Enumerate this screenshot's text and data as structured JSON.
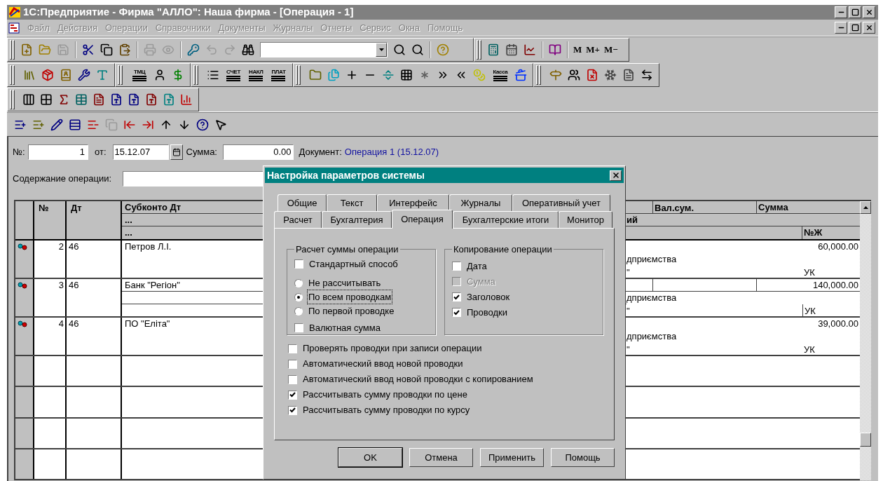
{
  "window": {
    "title": "1С:Предприятие - Фирма \"АЛЛО\": Наша фирма - [Операция - 1]"
  },
  "menu": [
    {
      "label": "Файл",
      "disabled": true
    },
    {
      "label": "Действия",
      "disabled": true
    },
    {
      "label": "Операции",
      "disabled": true
    },
    {
      "label": "Справочники",
      "disabled": true
    },
    {
      "label": "Документы",
      "disabled": true
    },
    {
      "label": "Журналы",
      "disabled": true
    },
    {
      "label": "Отчеты",
      "disabled": true
    },
    {
      "label": "Сервис",
      "disabled": true
    },
    {
      "label": "Окна",
      "disabled": true
    },
    {
      "label": "Помощь",
      "disabled": true
    }
  ],
  "toolbar_1": {
    "buttons": [
      {
        "disabled": false
      },
      {
        "disabled": false
      },
      {
        "disabled": true
      },
      {
        "disabled": false
      },
      {
        "disabled": false
      },
      {
        "disabled": false
      },
      {
        "disabled": true
      },
      {
        "disabled": true
      },
      {
        "disabled": false
      },
      {
        "disabled": true
      },
      {
        "disabled": true
      },
      {
        "disabled": false
      },
      {
        "disabled": false
      },
      {
        "disabled": false
      },
      {
        "disabled": false
      },
      {
        "disabled": false
      },
      {
        "disabled": false
      },
      {
        "disabled": false
      },
      {
        "disabled": false
      }
    ],
    "memory_buttons": [
      "M",
      "M+",
      "M−"
    ]
  },
  "toolbar_2": {
    "labels": [
      "ТМЦ",
      "СЧЕТ",
      "НАКЛ",
      "ПЛАТ",
      "Касса"
    ]
  },
  "toolbar_4": {
    "buttons": [
      {
        "disabled": false
      },
      {
        "disabled": false
      },
      {
        "disabled": false
      },
      {
        "disabled": false
      },
      {
        "disabled": false
      },
      {
        "disabled": true
      },
      {
        "disabled": false
      },
      {
        "disabled": false
      },
      {
        "disabled": false
      },
      {
        "disabled": false
      },
      {
        "disabled": false
      },
      {
        "disabled": false
      }
    ]
  },
  "form": {
    "number_label": "№:",
    "number": "1",
    "date_label": "от:",
    "date": "15.12.07",
    "sum_label": "Сумма:",
    "sum": "0.00",
    "document_label": "Документ:",
    "document_link": "Операция 1 (15.12.07)",
    "content_label": "Содержание операции:"
  },
  "table": {
    "header": {
      "number": "№",
      "debit": "Дт",
      "subkonto": [
        "Субконто Дт",
        "...",
        "..."
      ],
      "currency_sum": "Вал.сум.",
      "sum": "Сумма",
      "line_2": "ий",
      "journal": "№Ж"
    },
    "rows": [
      {
        "number": "2",
        "debit": "46",
        "subkonto": "Петров Л.І.",
        "amount": "60,000.00",
        "line_2": "дприємства",
        "line_3": "\"",
        "journal": "УК",
        "selected": false
      },
      {
        "number": "3",
        "debit": "46",
        "subkonto": "Банк \"Регіон\"",
        "amount": "140,000.00",
        "line_2": "дприємства",
        "line_3": "\"",
        "journal": "УК",
        "selected": true
      },
      {
        "number": "4",
        "debit": "46",
        "subkonto": "ПО \"Еліта\"",
        "amount": "39,000.00",
        "line_2": "дприємства",
        "line_3": "\"",
        "journal": "УК",
        "selected": false
      }
    ]
  },
  "dialog": {
    "title": "Настройка параметров системы",
    "tabs_row_1": [
      {
        "label": "Общие",
        "selected": false
      },
      {
        "label": "Текст",
        "selected": false
      },
      {
        "label": "Интерфейс",
        "selected": false
      },
      {
        "label": "Журналы",
        "selected": false
      },
      {
        "label": "Оперативный учет",
        "selected": false
      }
    ],
    "tabs_row_2": [
      {
        "label": "Расчет",
        "selected": false
      },
      {
        "label": "Бухгалтерия",
        "selected": false
      },
      {
        "label": "Операция",
        "selected": true
      },
      {
        "label": "Бухгалтерские итоги",
        "selected": false
      },
      {
        "label": "Монитор",
        "selected": false
      }
    ],
    "sum_group": {
      "title": "Расчет суммы операции",
      "standard": {
        "label": "Стандартный способ",
        "checked": false
      },
      "radios": [
        {
          "label": "Не рассчитывать",
          "selected": false
        },
        {
          "label": "По всем проводкам",
          "selected": true
        },
        {
          "label": "По первой проводке",
          "selected": false
        }
      ],
      "currency": {
        "label": "Валютная сумма",
        "checked": false
      }
    },
    "copy_group": {
      "title": "Копирование операции",
      "options": [
        {
          "label": "Дата",
          "checked": false,
          "disabled": false
        },
        {
          "label": "Сумма",
          "checked": false,
          "disabled": true
        },
        {
          "label": "Заголовок",
          "checked": true,
          "disabled": false
        },
        {
          "label": "Проводки",
          "checked": true,
          "disabled": false
        }
      ]
    },
    "options": [
      {
        "label": "Проверять проводки при записи операции",
        "checked": false
      },
      {
        "label": "Автоматический ввод новой проводки",
        "checked": false
      },
      {
        "label": "Автоматический ввод новой проводки с копированием",
        "checked": false
      },
      {
        "label": "Рассчитывать сумму проводки по цене",
        "checked": true
      },
      {
        "label": "Рассчитывать сумму проводки по курсу",
        "checked": true
      }
    ],
    "buttons": [
      "OK",
      "Отмена",
      "Применить",
      "Помощь"
    ]
  }
}
